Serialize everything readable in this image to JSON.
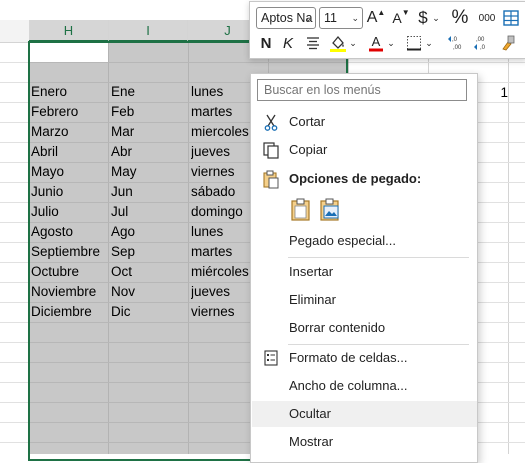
{
  "columns": [
    {
      "letter": "H",
      "selected": true
    },
    {
      "letter": "I",
      "selected": true
    },
    {
      "letter": "J",
      "selected": true
    },
    {
      "letter": "",
      "selected": false
    }
  ],
  "rows": [
    [
      "Enero",
      "Ene",
      "lunes"
    ],
    [
      "Febrero",
      "Feb",
      "martes"
    ],
    [
      "Marzo",
      "Mar",
      "miercoles"
    ],
    [
      "Abril",
      "Abr",
      "jueves"
    ],
    [
      "Mayo",
      "May",
      "viernes"
    ],
    [
      "Junio",
      "Jun",
      "sábado"
    ],
    [
      "Julio",
      "Jul",
      "domingo"
    ],
    [
      "Agosto",
      "Ago",
      "lunes"
    ],
    [
      "Septiembre",
      "Sep",
      "martes"
    ],
    [
      "Octubre",
      "Oct",
      "miércoles"
    ],
    [
      "Noviembre",
      "Nov",
      "jueves"
    ],
    [
      "Diciembre",
      "Dic",
      "viernes"
    ]
  ],
  "side_value": "1",
  "mini_toolbar": {
    "font_name": "Aptos Na",
    "font_size": "11",
    "grow_font": "A",
    "shrink_font": "A",
    "currency": "$",
    "percent": "%",
    "thousands": "000",
    "bold": "N",
    "italic": "K"
  },
  "menu": {
    "search_placeholder": "Buscar en los menús",
    "cut": "Cortar",
    "copy": "Copiar",
    "paste_options": "Opciones de pegado:",
    "paste_special": "Pegado especial...",
    "insert": "Insertar",
    "delete": "Eliminar",
    "clear_contents": "Borrar contenido",
    "format_cells": "Formato de celdas...",
    "column_width": "Ancho de columna...",
    "hide": "Ocultar",
    "show": "Mostrar"
  },
  "colors": {
    "selection_border": "#1e7145",
    "selection_fill": "#c8c8c8",
    "highlight_yellow": "#ffff00",
    "font_red": "#e00000"
  }
}
